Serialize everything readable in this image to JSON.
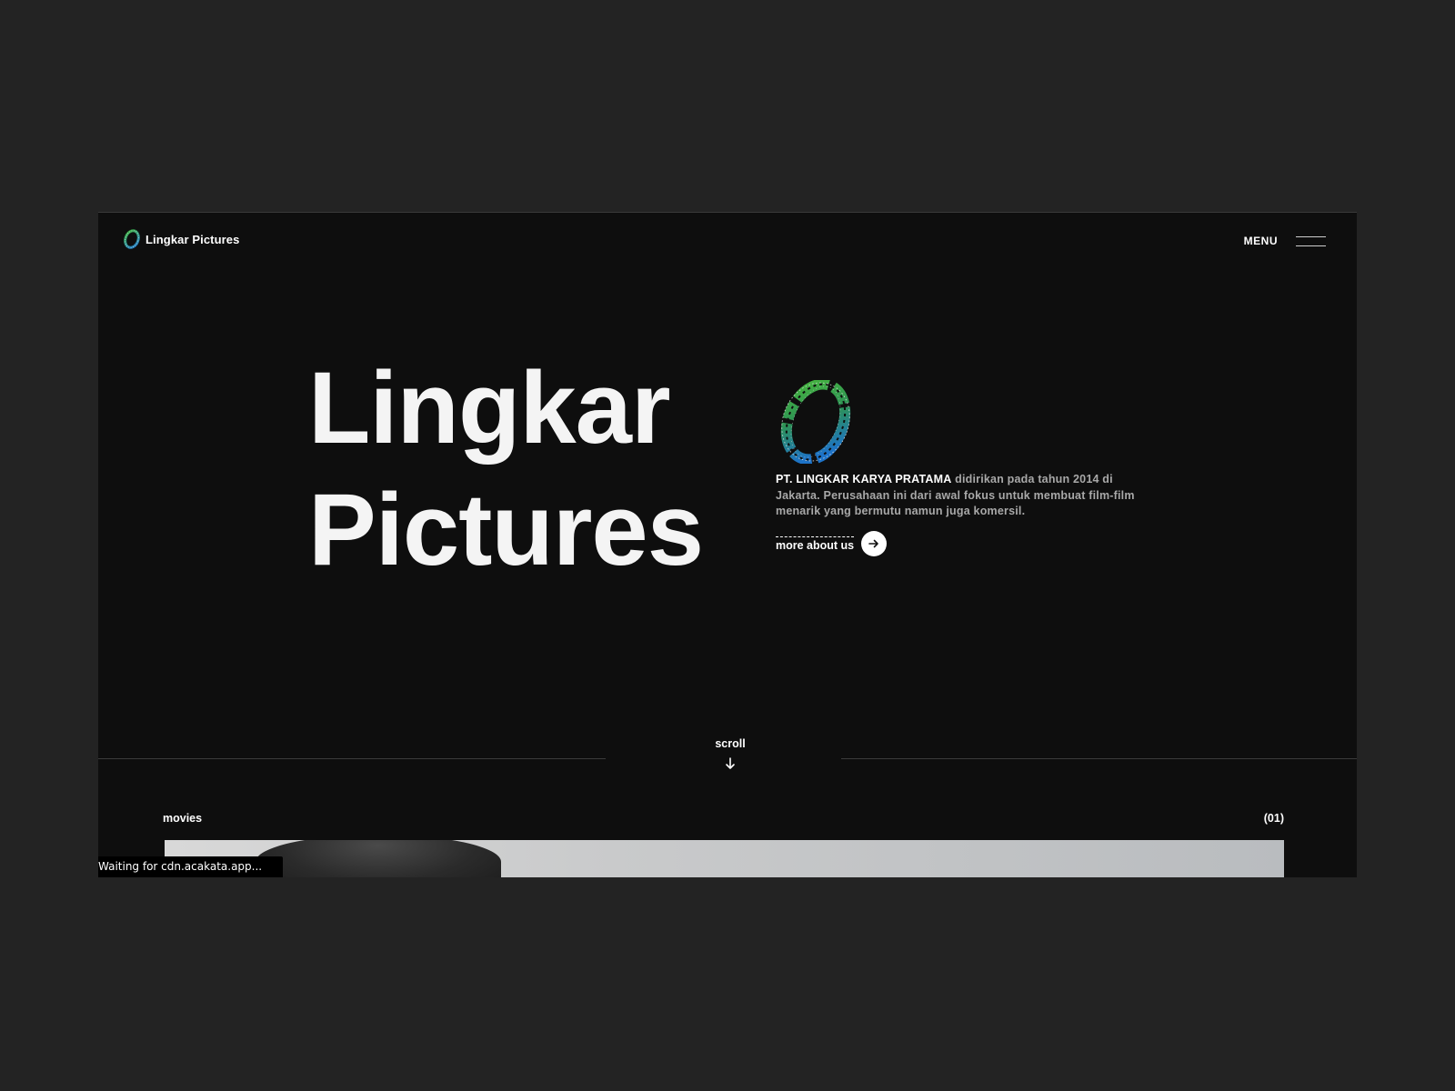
{
  "header": {
    "logo_text": "Lingkar Pictures",
    "menu_label": "MENU"
  },
  "hero": {
    "title_line1": "Lingkar",
    "title_line2": "Pictures",
    "about_company": "PT. LINGKAR KARYA PRATAMA",
    "about_text": " didirikan pada tahun 2014 di Jakarta. Perusahaan ini dari awal fokus untuk membuat film-film menarik yang bermutu namun juga komersil.",
    "more_label": "more about us"
  },
  "scroll": {
    "label": "scroll"
  },
  "movies": {
    "label": "movies",
    "count": "(01)"
  },
  "status_bar": {
    "text": "Waiting for cdn.acakata.app..."
  },
  "icons": {
    "logo": "ring-logo-icon",
    "menu": "hamburger-icon",
    "more": "arrow-right-icon",
    "scroll": "arrow-down-icon"
  },
  "colors": {
    "page_bg": "#232323",
    "site_bg": "#0e0e0e",
    "text_primary": "#ffffff",
    "text_secondary": "#a8a8a8",
    "emblem_green": "#3fb63a",
    "emblem_blue": "#1e78d2"
  }
}
